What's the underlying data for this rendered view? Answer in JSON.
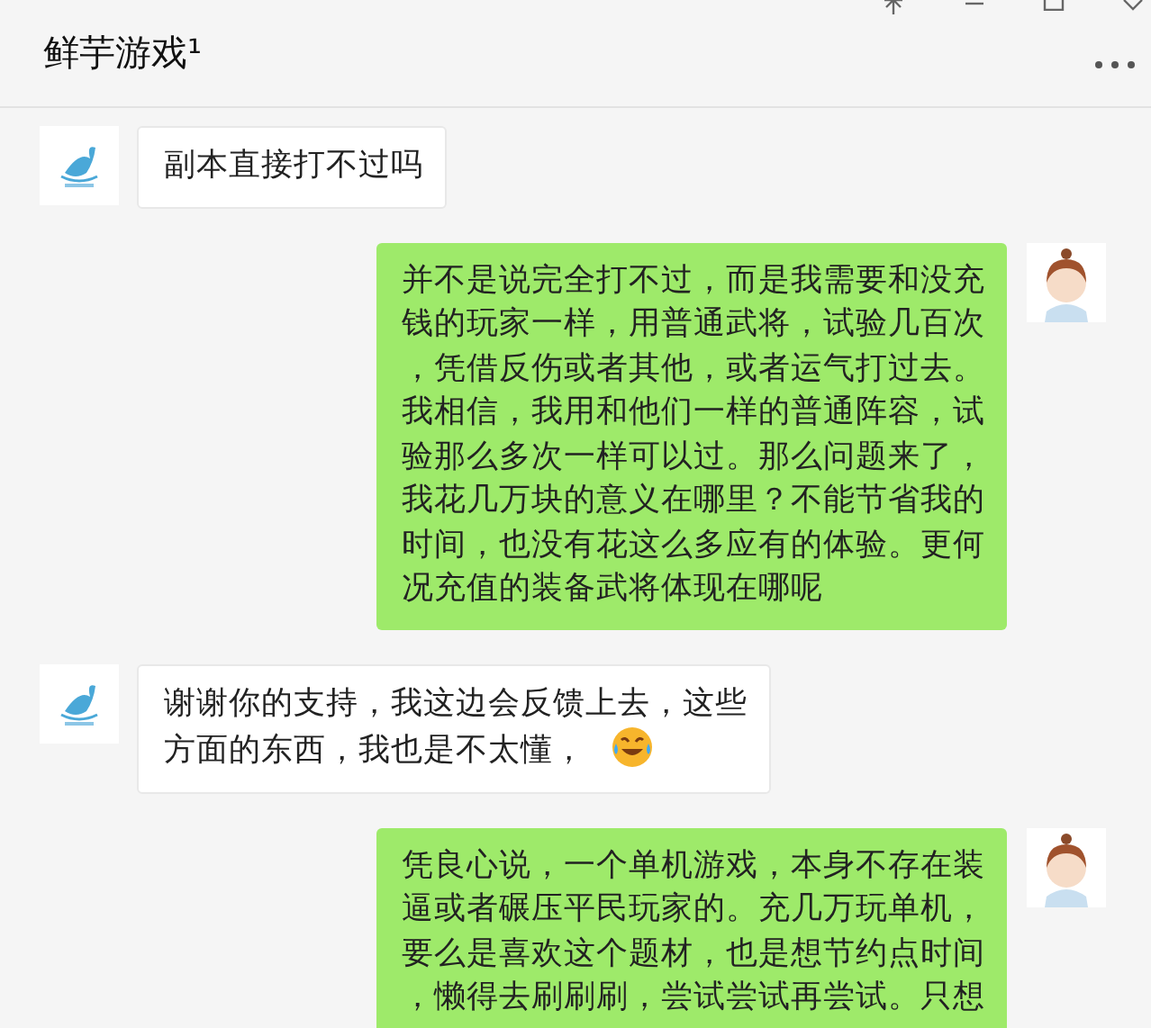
{
  "window": {
    "title": "鲜芋游戏¹"
  },
  "messages": [
    {
      "kind": "received",
      "lines": [
        "副本直接打不过吗"
      ]
    },
    {
      "kind": "sent",
      "lines": [
        "并不是说完全打不过，而是我需要和没充",
        "钱的玩家一样，用普通武将，试验几百次",
        "，凭借反伤或者其他，或者运气打过去。",
        "我相信，我用和他们一样的普通阵容，试",
        "验那么多次一样可以过。那么问题来了，",
        "我花几万块的意义在哪里？不能节省我的",
        "时间，也没有花这么多应有的体验。更何",
        "况充值的装备武将体现在哪呢"
      ]
    },
    {
      "kind": "received",
      "lines": [
        "谢谢你的支持，我这边会反馈上去，这些",
        "方面的东西，我也是不太懂，"
      ],
      "emoji": true
    },
    {
      "kind": "sent",
      "lines": [
        "凭良心说，一个单机游戏，本身不存在装",
        "逼或者碾压平民玩家的。充几万玩单机，",
        "要么是喜欢这个题材，也是想节约点时间",
        "，懒得去刷刷刷，尝试尝试再尝试。只想"
      ]
    }
  ]
}
